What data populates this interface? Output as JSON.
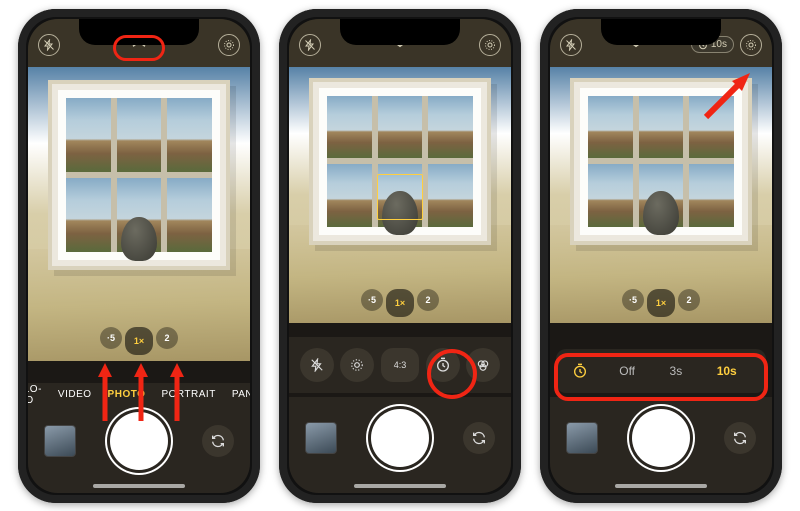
{
  "zoom_levels": [
    "·5",
    "1×",
    "2"
  ],
  "modes": [
    "SLO-MO",
    "VIDEO",
    "PHOTO",
    "PORTRAIT",
    "PANO"
  ],
  "selected_mode": "PHOTO",
  "tools_ratio": "4:3",
  "timer": {
    "badge": "10s",
    "options": [
      "Off",
      "3s",
      "10s"
    ],
    "selected": "10s"
  },
  "annotations": {
    "red": "#f02514"
  }
}
